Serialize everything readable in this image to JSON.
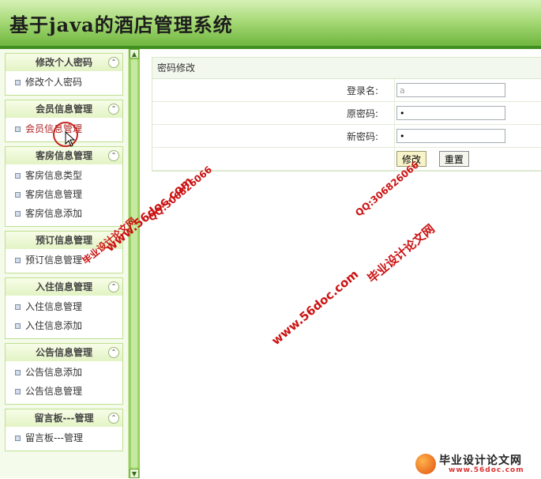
{
  "header": {
    "title": "基于java的酒店管理系统"
  },
  "sidebar": {
    "groups": [
      {
        "title": "修改个人密码",
        "items": [
          {
            "label": "修改个人密码"
          }
        ]
      },
      {
        "title": "会员信息管理",
        "items": [
          {
            "label": "会员信息管理"
          }
        ]
      },
      {
        "title": "客房信息管理",
        "items": [
          {
            "label": "客房信息类型"
          },
          {
            "label": "客房信息管理"
          },
          {
            "label": "客房信息添加"
          }
        ]
      },
      {
        "title": "预订信息管理",
        "items": [
          {
            "label": "预订信息管理"
          }
        ]
      },
      {
        "title": "入住信息管理",
        "items": [
          {
            "label": "入住信息管理"
          },
          {
            "label": "入住信息添加"
          }
        ]
      },
      {
        "title": "公告信息管理",
        "items": [
          {
            "label": "公告信息添加"
          },
          {
            "label": "公告信息管理"
          }
        ]
      },
      {
        "title": "留言板---管理",
        "items": [
          {
            "label": "留言板---管理"
          }
        ]
      }
    ],
    "collapse_glyph": "⌃"
  },
  "panel": {
    "title": "密码修改",
    "fields": [
      {
        "label": "登录名:",
        "value": "a"
      },
      {
        "label": "原密码:",
        "value": "•"
      },
      {
        "label": "新密码:",
        "value": "•"
      }
    ],
    "submit_label": "修改",
    "reset_label": "重置"
  },
  "watermarks": {
    "site": "www.56doc.com",
    "qq": "QQ:306826066",
    "brand": "毕业设计论文网",
    "brand_url": "www.56doc.com"
  },
  "scroll": {
    "up": "▲",
    "down": "▼"
  },
  "colors": {
    "accent": "#6fb63f",
    "header_border": "#3e8f1f",
    "watermark": "#cc1111"
  }
}
